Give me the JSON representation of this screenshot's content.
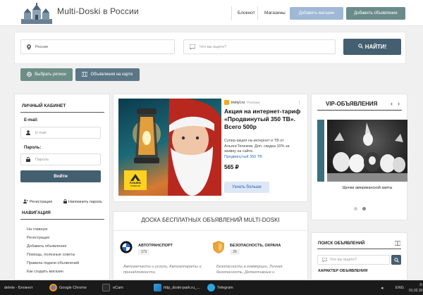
{
  "header": {
    "site_title": "Multi-Doski в России",
    "nav_links": [
      "Блокнот",
      "Магазины"
    ],
    "add_shop_label": "Добавить магазин",
    "add_ad_label": "Добавить объявление"
  },
  "search": {
    "region_value": "Россия",
    "query_placeholder": "Что вы ищете?",
    "find_label": "НАЙТИ!"
  },
  "region_button": "Выбрать регион",
  "map_button": "Объявления на карте",
  "login": {
    "title": "ЛИЧНЫЙ КАБИНЕТ",
    "email_label": "E-mail:",
    "email_placeholder": "E-mail",
    "password_label": "Пароль:",
    "password_placeholder": "Пароль",
    "login_label": "Войти",
    "register_label": "Регистрация",
    "remind_label": "Напомнить пароль"
  },
  "navigation": {
    "title": "НАВИГАЦИЯ",
    "items": [
      "На главную",
      "Регистрация",
      "Добавить объявление",
      "Помощь, полезные советы",
      "Правила подачи объявлений",
      "Как создать магазин"
    ]
  },
  "ad": {
    "source": "inetyl.ru",
    "source_tag": "Реклама",
    "headline": "Акция на интернет-тариф «Продвинутый 350 ТВ». Всего 500р",
    "description": "Супер-акция на интернет и ТВ от АльянсТелеком. Доп. скидка 10% за заявку на сайте.",
    "product": "Продвинутый 350 ТВ",
    "price": "565 ₽",
    "cta": "Узнать больше",
    "brand_logo": "Альянс",
    "brand_sub": "ТЕЛЕКОМ"
  },
  "vip": {
    "title": "VIP-ОБЪЯВЛЕНИЯ",
    "caption": "Щенки американской акиты"
  },
  "board": {
    "title": "ДОСКА БЕСПЛАТНЫХ ОБЪЯВЛЕНИЙ MULTI-DOSKI",
    "categories": [
      {
        "name": "АВТОТРАНСПОРТ",
        "count": "173",
        "sub": "Автозапчасти и услуги, Автоаппараты и принадлежности,"
      },
      {
        "name": "БЕЗОПАСНОСТЬ, ОХРАНА",
        "count": "26",
        "sub": "Безопасность в коммерции, Личная безопасность, Детективные и"
      }
    ]
  },
  "search_ads": {
    "title": "ПОИСК ОБЪЯВЛЕНИЙ",
    "placeholder": "Что вы ищете?",
    "trait_label": "ХАРАКТЕР ОБЪЯВЛЕНИЯ"
  },
  "taskbar": {
    "items": [
      "delete - Блокнот",
      "Google Chrome",
      "oCam",
      "http_doski-park.ru_...",
      "Telegram"
    ],
    "lang": "ENG",
    "time": "9:39",
    "date": "01.02.2021"
  },
  "colors": {
    "primary": "#445f70",
    "add_shop": "#9fb8d6",
    "add_ad": "#6b8b8b",
    "region_btn": "#6d8e86",
    "map_btn": "#5b7786",
    "link": "#2a6fb5",
    "cta_bg": "#dde7f6"
  }
}
